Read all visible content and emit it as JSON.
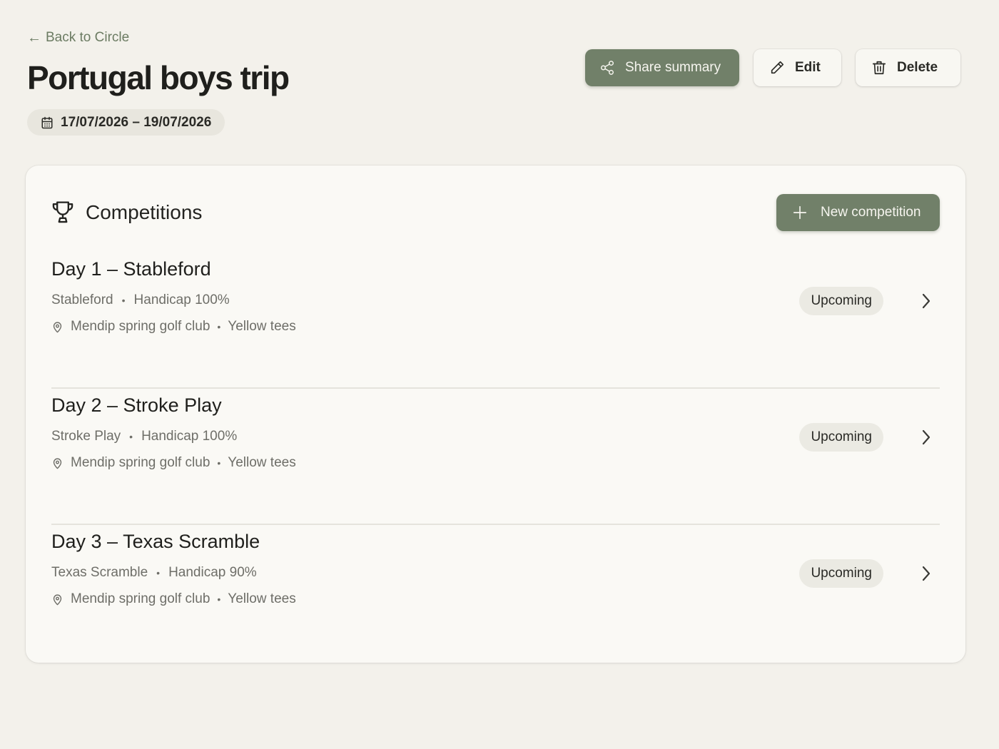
{
  "header": {
    "back_label": "Back to Circle",
    "title": "Portugal boys trip",
    "date_range": "17/07/2026 – 19/07/2026"
  },
  "actions": {
    "share_label": "Share summary",
    "edit_label": "Edit",
    "delete_label": "Delete"
  },
  "competitions": {
    "title": "Competitions",
    "new_label": "New competition",
    "items": [
      {
        "name": "Day 1 – Stableford",
        "format": "Stableford",
        "handicap": "Handicap 100%",
        "course": "Mendip spring golf club",
        "tees": "Yellow tees",
        "status": "Upcoming"
      },
      {
        "name": "Day 2 – Stroke Play",
        "format": "Stroke Play",
        "handicap": "Handicap 100%",
        "course": "Mendip spring golf club",
        "tees": "Yellow tees",
        "status": "Upcoming"
      },
      {
        "name": "Day 3 – Texas Scramble",
        "format": "Texas Scramble",
        "handicap": "Handicap 90%",
        "course": "Mendip spring golf club",
        "tees": "Yellow tees",
        "status": "Upcoming"
      }
    ]
  },
  "colors": {
    "background": "#f3f1eb",
    "accent": "#718069",
    "card": "#faf9f5"
  },
  "icons": {
    "back": "arrow-left-icon",
    "date": "calendar-icon",
    "share": "share-icon",
    "edit": "pencil-icon",
    "delete": "trash-icon",
    "section": "trophy-icon",
    "new": "plus-icon",
    "location": "map-pin-icon",
    "open": "chevron-right-icon"
  }
}
